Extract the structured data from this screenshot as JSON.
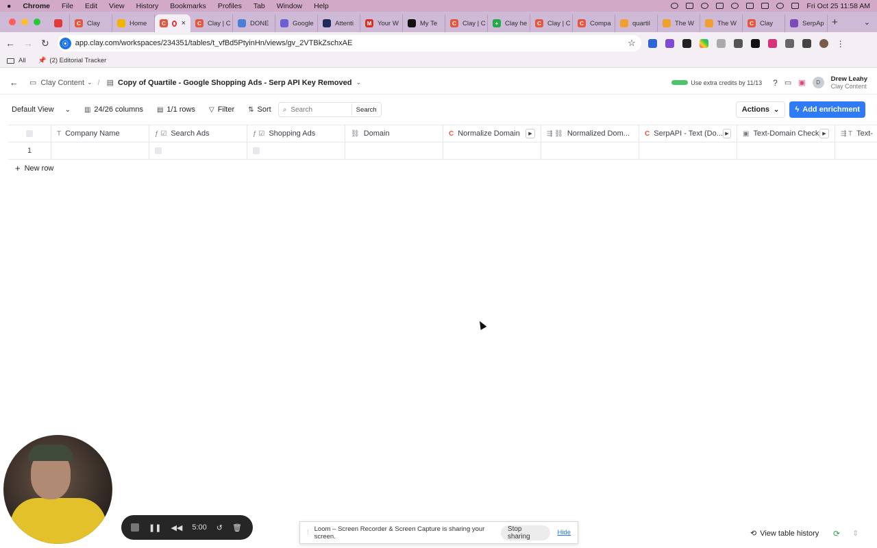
{
  "macbar": {
    "apple": "",
    "menus": [
      "Chrome",
      "File",
      "Edit",
      "View",
      "History",
      "Bookmarks",
      "Profiles",
      "Tab",
      "Window",
      "Help"
    ],
    "clock": "Fri Oct 25  11:58 AM"
  },
  "tabs": [
    {
      "label": "",
      "color": "#e03a3a",
      "fav": ""
    },
    {
      "label": "Clay",
      "color": "#e8553d",
      "fav": "C"
    },
    {
      "label": "Home",
      "color": "#f2b400",
      "fav": ""
    },
    {
      "label": "",
      "color": "#e8553d",
      "fav": "C",
      "active": true
    },
    {
      "label": "Clay | C",
      "color": "#e8553d",
      "fav": "C"
    },
    {
      "label": "DONE",
      "color": "#4a7fd6",
      "fav": ""
    },
    {
      "label": "Google",
      "color": "#6b5fd3",
      "fav": ""
    },
    {
      "label": "Attenti",
      "color": "#1e2a5a",
      "fav": ""
    },
    {
      "label": "Your W",
      "color": "#d93025",
      "fav": "M"
    },
    {
      "label": "My Te",
      "color": "#111111",
      "fav": ""
    },
    {
      "label": "Clay | C",
      "color": "#e8553d",
      "fav": "C"
    },
    {
      "label": "Clay he",
      "color": "#22a845",
      "fav": "+"
    },
    {
      "label": "Clay | C",
      "color": "#e8553d",
      "fav": "C"
    },
    {
      "label": "Compa",
      "color": "#e8553d",
      "fav": "C"
    },
    {
      "label": "quartil",
      "color": "#f0a030",
      "fav": ""
    },
    {
      "label": "The W",
      "color": "#f0a030",
      "fav": ""
    },
    {
      "label": "The W",
      "color": "#f0a030",
      "fav": ""
    },
    {
      "label": "Clay",
      "color": "#e8553d",
      "fav": "C"
    },
    {
      "label": "SerpAp",
      "color": "#7a4ab8",
      "fav": ""
    }
  ],
  "address": {
    "url": "app.clay.com/workspaces/234351/tables/t_vfBd5PtyinHn/views/gv_2VTBkZschxAE"
  },
  "bookmarks": {
    "all": "All",
    "editorial": "(2) Editorial Tracker"
  },
  "topnav": {
    "workspace": "Clay Content",
    "table_title": "Copy of Quartile - Google Shopping Ads - Serp API Key Removed",
    "credits": "Use extra credits by 11/13",
    "user_name": "Drew Leahy",
    "user_role": "Clay Content",
    "user_initial": "D"
  },
  "toolbar": {
    "view": "Default View",
    "columns": "24/26 columns",
    "rows": "1/1 rows",
    "filter": "Filter",
    "sort": "Sort",
    "search_placeholder": "Search",
    "search_button": "Search",
    "actions": "Actions",
    "add_enrichment": "Add enrichment"
  },
  "table": {
    "columns": [
      {
        "label": "Company Name",
        "icon": "T"
      },
      {
        "label": "Search Ads",
        "icon": "ƒ ☑"
      },
      {
        "label": "Shopping Ads",
        "icon": "ƒ ☑"
      },
      {
        "label": "Domain",
        "icon": "⛓"
      },
      {
        "label": "Normalize Domain",
        "icon": "C",
        "run": true
      },
      {
        "label": "Normalized Dom...",
        "icon": "⇶ ⛓"
      },
      {
        "label": "SerpAPI - Text (Do...",
        "icon": "C",
        "run": true
      },
      {
        "label": "Text-Domain Check",
        "icon": "▣",
        "run": true
      },
      {
        "label": "Text-",
        "icon": "⇶ T"
      }
    ],
    "row_number": "1",
    "new_row": "New row"
  },
  "recorder": {
    "time": "5:00"
  },
  "loom": {
    "message": "Loom – Screen Recorder & Screen Capture is sharing your screen.",
    "stop": "Stop sharing",
    "hide": "Hide"
  },
  "footer": {
    "history": "View table history"
  }
}
